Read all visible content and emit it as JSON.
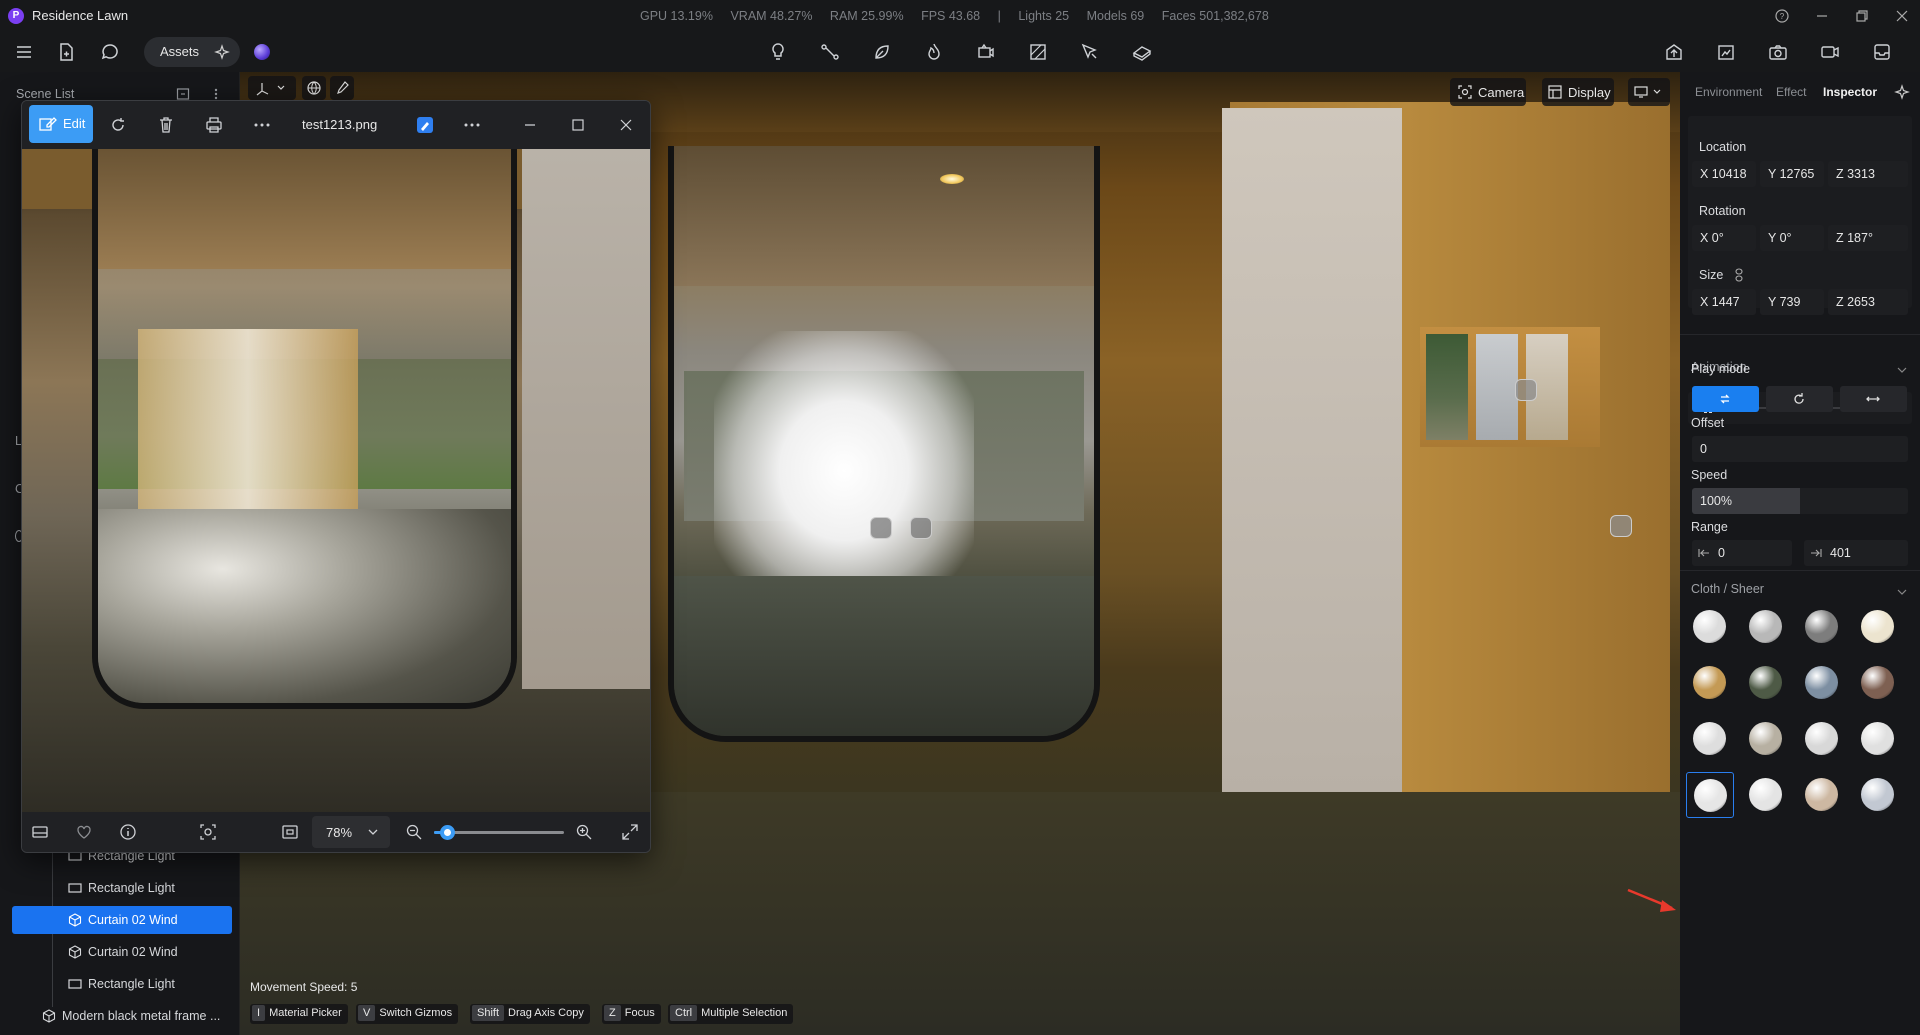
{
  "app": {
    "title": "Residence Lawn",
    "logo_letter": "P"
  },
  "stats": {
    "gpu": "GPU 13.19%",
    "vram": "VRAM 48.27%",
    "ram": "RAM 25.99%",
    "fps": "FPS 43.68",
    "sep": "|",
    "lights": "Lights 25",
    "models": "Models 69",
    "faces": "Faces 501,382,678"
  },
  "toolbar": {
    "assets_label": "Assets"
  },
  "scene": {
    "header": "Scene List",
    "partial_letters": [
      "L",
      "C"
    ],
    "items": [
      {
        "label": "Rectangle Light",
        "icon": "rectangle-icon"
      },
      {
        "label": "Rectangle Light",
        "icon": "rectangle-icon"
      },
      {
        "label": "Curtain 02 Wind",
        "icon": "cube-icon",
        "selected": true
      },
      {
        "label": "Curtain 02 Wind",
        "icon": "cube-icon"
      },
      {
        "label": "Rectangle Light",
        "icon": "rectangle-icon"
      },
      {
        "label": "Modern black metal frame ...",
        "icon": "cube-icon"
      }
    ]
  },
  "viewport": {
    "camera_label": "Camera",
    "display_label": "Display",
    "movement_speed": "Movement Speed: 5",
    "shortcuts": [
      {
        "key": "I",
        "label": "Material Picker"
      },
      {
        "key": "V",
        "label": "Switch Gizmos"
      },
      {
        "key": "Shift",
        "label": "Drag Axis Copy"
      },
      {
        "key": "Z",
        "label": "Focus"
      },
      {
        "key": "Ctrl",
        "label": "Multiple Selection"
      }
    ]
  },
  "viewer": {
    "edit_label": "Edit",
    "filename": "test1213.png",
    "zoom": "78%",
    "zoom_fraction": 0.1
  },
  "inspector": {
    "tabs": [
      "Environment",
      "Effect",
      "Inspector"
    ],
    "active_tab": "Inspector",
    "location_label": "Location",
    "location": {
      "x": "X  10418",
      "y": "Y  12765",
      "z": "Z  3313"
    },
    "rotation_label": "Rotation",
    "rotation": {
      "x": "X  0°",
      "y": "Y  0°",
      "z": "Z  187°"
    },
    "size_label": "Size",
    "size": {
      "x": "X  1447",
      "y": "Y  739",
      "z": "Z  2653"
    },
    "animation_title": "Animation",
    "animation_progress": 0.5,
    "play_mode_label": "Play mode",
    "offset_label": "Offset",
    "offset_value": "0",
    "speed_label": "Speed",
    "speed_value": "100%",
    "range_label": "Range",
    "range_start": "0",
    "range_end": "401",
    "material_title": "Cloth / Sheer",
    "swatch_colors": [
      "#dcdcdc",
      "#b8b8b8",
      "#7d7d7d",
      "#ece4cf",
      "#c49a55",
      "#4e5a46",
      "#7d8fa2",
      "#7e6052",
      "#dedede",
      "#b7b0a2",
      "#d8d8d8",
      "#e0e0e0",
      "#e6e6e6",
      "#e4e4e4",
      "#cdb8a2",
      "#c2c8d2"
    ],
    "selected_swatch": 12
  },
  "colors": {
    "accent": "#1a73f0",
    "viewer_accent": "#3c9cf5"
  }
}
